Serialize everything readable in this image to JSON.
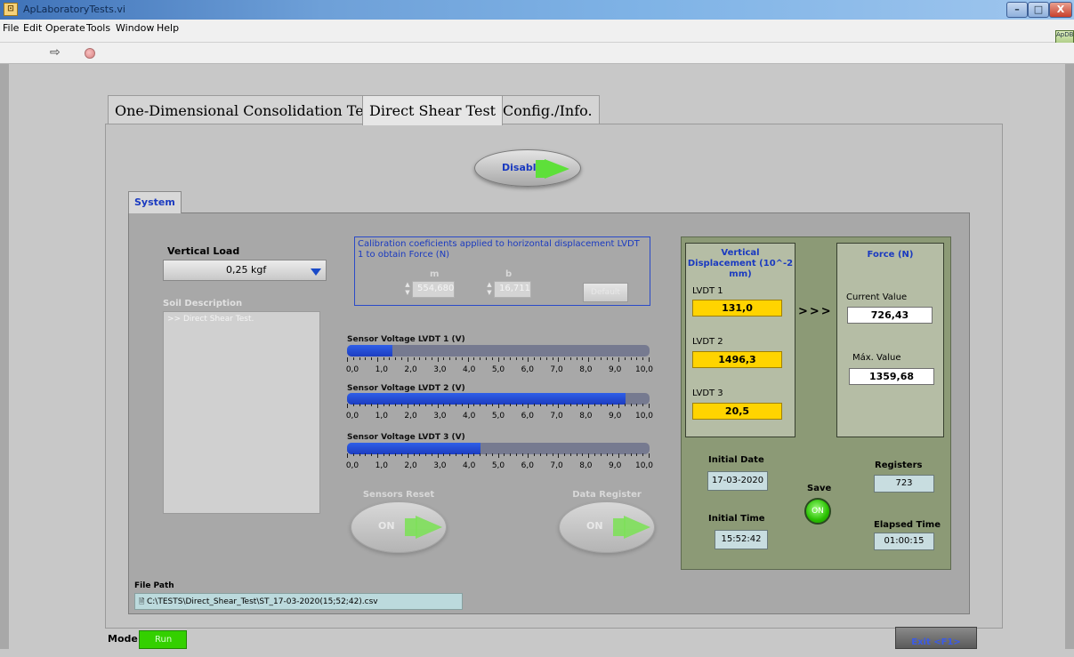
{
  "window": {
    "title": "ApLaboratoryTests.vi",
    "app_icon": "labview-icon",
    "min": "–",
    "max": "□",
    "close": "X"
  },
  "menu": [
    "File",
    "Edit",
    "Operate",
    "Tools",
    "Window",
    "Help"
  ],
  "toolbar": {
    "run_icon": "run-arrow-icon",
    "run_glyph": "⇨",
    "stop_icon": "abort-stop-icon",
    "vi_icon_text": "ApDB"
  },
  "tabs": [
    "One-Dimensional Consolidation Test",
    "Direct Shear Test",
    "Config./Info."
  ],
  "active_tab": "Direct Shear Test",
  "disable_button": "Disable",
  "subtab": "System",
  "vertical_load": {
    "label": "Vertical Load",
    "value": "0,25 kgf"
  },
  "soil": {
    "label": "Soil Description",
    "text": ">> Direct Shear Test."
  },
  "calibration": {
    "text": "Calibration coeficients applied to horizontal displacement LVDT 1 to obtain Force (N)",
    "m_label": "m",
    "m_value": "554,680",
    "b_label": "b",
    "b_value": "16,711",
    "default_button": "Default"
  },
  "sensors": [
    {
      "label": "Sensor Voltage LVDT 1 (V)",
      "value": 1.5
    },
    {
      "label": "Sensor Voltage LVDT 2 (V)",
      "value": 9.2
    },
    {
      "label": "Sensor Voltage LVDT 3 (V)",
      "value": 4.4
    }
  ],
  "scale": {
    "min": 0,
    "max": 10,
    "labels": [
      "0,0",
      "1,0",
      "2,0",
      "3,0",
      "4,0",
      "5,0",
      "6,0",
      "7,0",
      "8,0",
      "9,0",
      "10,0"
    ]
  },
  "buttons": {
    "sensors_reset": {
      "label": "Sensors Reset",
      "state": "ON"
    },
    "data_register": {
      "label": "Data Register",
      "state": "ON"
    }
  },
  "vertical_displacement": {
    "title": "Vertical Displacement (10^-2 mm)",
    "lvdt1_label": "LVDT 1",
    "lvdt1": "131,0",
    "lvdt2_label": "LVDT 2",
    "lvdt2": "1496,3",
    "lvdt3_label": "LVDT 3",
    "lvdt3": "20,5"
  },
  "arrows": ">>>",
  "force": {
    "title": "Force (N)",
    "current_label": "Current Value",
    "current": "726,43",
    "max_label": "Máx. Value",
    "max": "1359,68"
  },
  "initial_date": {
    "label": "Initial Date",
    "value": "17-03-2020"
  },
  "initial_time": {
    "label": "Initial Time",
    "value": "15:52:42"
  },
  "save": {
    "label": "Save",
    "led": "ON"
  },
  "registers": {
    "label": "Registers",
    "value": "723"
  },
  "elapsed": {
    "label": "Elapsed Time",
    "value": "01:00:15"
  },
  "file_path": {
    "label": "File Path",
    "value": "C:\\TESTS\\Direct_Shear_Test\\ST_17-03-2020(15;52;42).csv"
  },
  "mode": {
    "label": "Mode",
    "value": "Run"
  },
  "exit_button": "Exit <F1>",
  "colors": {
    "accent_blue": "#1a3ac0",
    "indicator_yellow": "#ffd400",
    "led_green": "#28c000",
    "panel_green": "#8c9a76"
  }
}
